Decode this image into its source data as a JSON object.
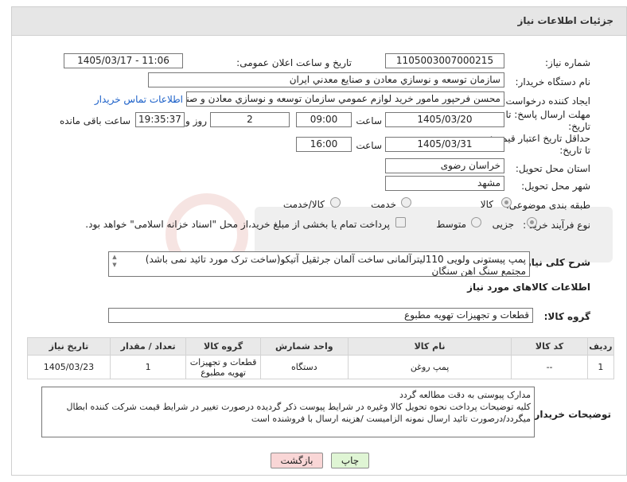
{
  "header": {
    "title": "جزئیات اطلاعات نیاز"
  },
  "form": {
    "need_number_label": "شماره نیاز:",
    "need_number": "1105003007000215",
    "announce_label": "تاریخ و ساعت اعلان عمومی:",
    "announce_value": "1405/03/17 - 11:06",
    "buyer_org_label": "نام دستگاه خریدار:",
    "buyer_org": "سازمان توسعه و نوسازي معادن و صنايع معدني ايران",
    "requester_label": "ایجاد کننده درخواست:",
    "requester": "محسن فرحپور مامور خريد لوازم عمومي سازمان توسعه و نوسازي معادن و صنايع",
    "contact_link": "اطلاعات تماس خریدار",
    "deadline_label_1": "مهلت ارسال پاسخ: تا",
    "deadline_label_2": "تاریخ:",
    "deadline_date": "1405/03/20",
    "time_label": "ساعت",
    "deadline_time": "09:00",
    "days_value": "2",
    "days_label": "روز و",
    "remaining_time": "19:35:37",
    "remaining_label": "ساعت باقی مانده",
    "validity_label_1": "حداقل تاریخ اعتبار قیمت:",
    "validity_label_2": "تا تاریخ:",
    "validity_date": "1405/03/31",
    "validity_time": "16:00",
    "province_label": "استان محل تحویل:",
    "province": "خراسان رضوی",
    "city_label": "شهر محل تحویل:",
    "city": "مشهد",
    "category_label": "طبقه بندی موضوعی:",
    "category_options": [
      "کالا",
      "خدمت",
      "کالا/خدمت"
    ],
    "process_label": "نوع فرآیند خرید :",
    "process_options": [
      "جزیی",
      "متوسط"
    ],
    "payment_note": "پرداخت تمام یا بخشی از مبلغ خرید،از محل \"اسناد خزانه اسلامی\" خواهد بود.",
    "description_label": "شرح کلی نیاز:",
    "description_lines": [
      "پمپ پیستونی ولویی 110لیترآلمانی ساخت آلمان  جرثقیل آتیکو(ساخت ترک مورد تائید نمی باشد)",
      "مجتمع سنگ اهن سنگان"
    ],
    "items_section_title": "اطلاعات کالاهای مورد نیاز",
    "goods_group_label": "گروه کالا:",
    "goods_group": "قطعات و تجهیزات تهویه مطبوع"
  },
  "table": {
    "headers": [
      "ردیف",
      "کد کالا",
      "نام کالا",
      "واحد شمارش",
      "گروه کالا",
      "تعداد / مقدار",
      "تاریخ نیاز"
    ],
    "rows": [
      [
        "1",
        "--",
        "پمپ روغن",
        "دستگاه",
        "قطعات و تجهیزات تهویه مطبوع",
        "1",
        "1405/03/23"
      ]
    ]
  },
  "buyer_notes": {
    "label": "توضیحات خریدار:",
    "lines": [
      "مدارک پیوستی به دقت مطالعه گردد",
      "کلیه توضیحات پرداخت نحوه تحویل کالا وغیره در شرایط پیوست ذکر گردیده درصورت تغییر در شرایط  قیمت شرکت کننده ابطال",
      "میگردد/درصورت تائید ارسال نمونه الزامیست /هزینه ارسال با فروشنده است"
    ]
  },
  "buttons": {
    "print": "چاپ",
    "back": "بازگشت"
  },
  "colors": {
    "header_bg": "#e6e6e6",
    "link": "#1a5fc8",
    "back_bg": "#f9d6d6",
    "print_bg": "#dff5d4"
  }
}
